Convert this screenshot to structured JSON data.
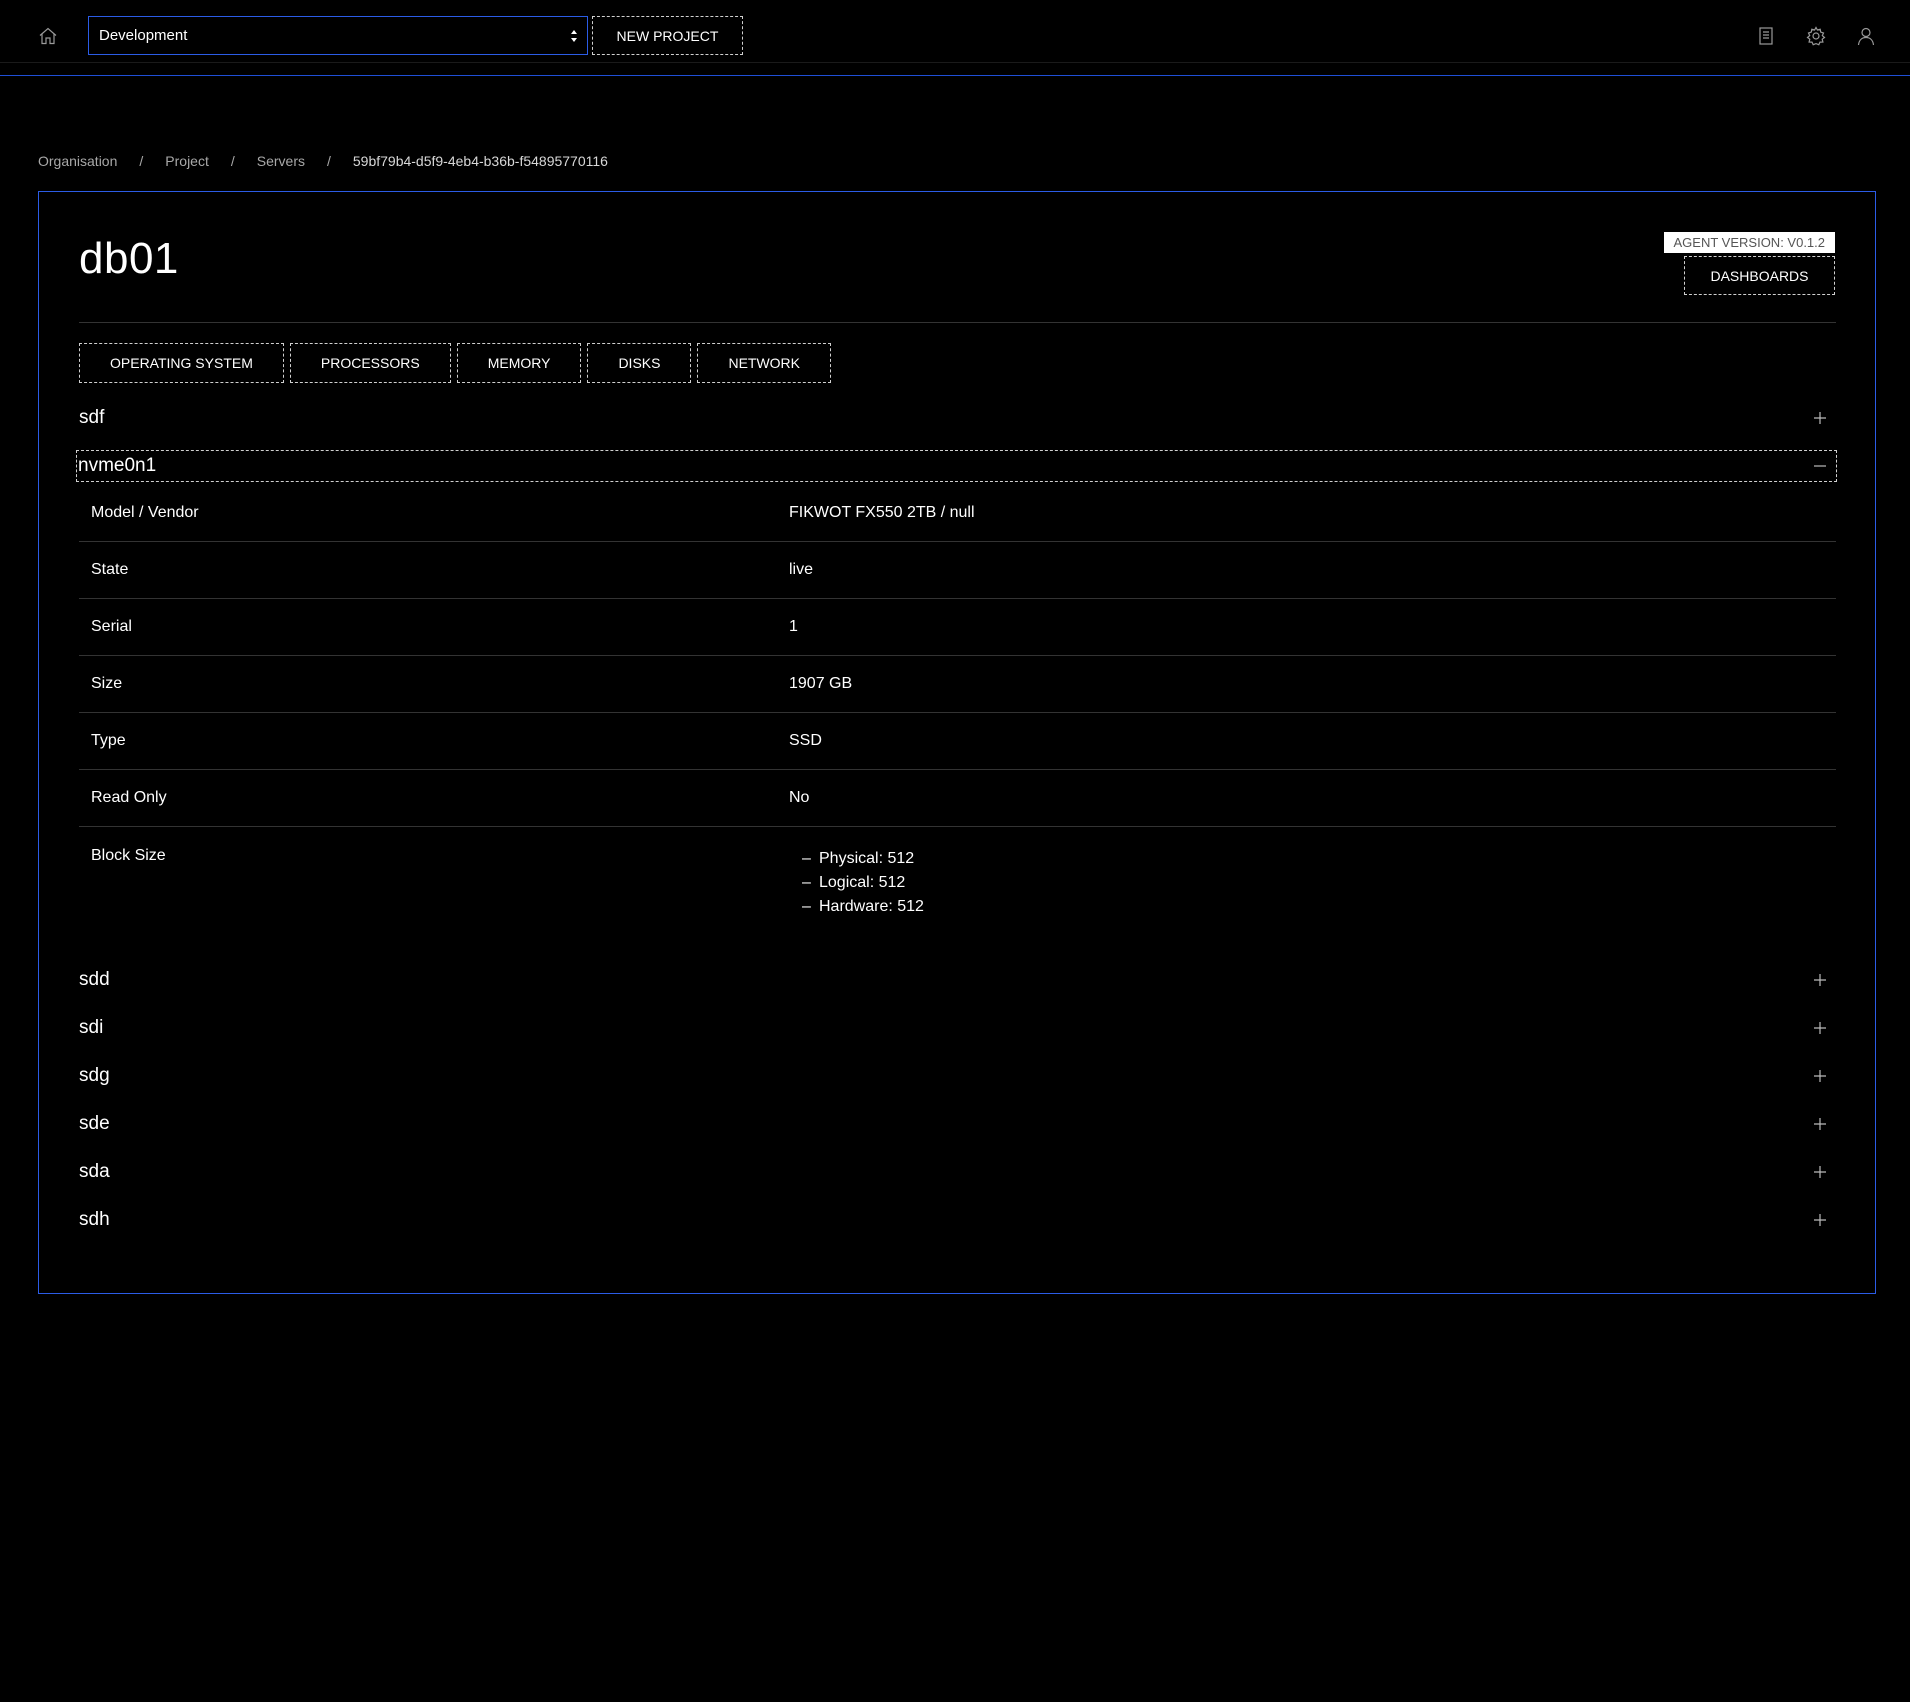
{
  "header": {
    "project_select": {
      "value": "Development"
    },
    "new_project_label": "NEW PROJECT"
  },
  "breadcrumb": [
    {
      "label": "Organisation"
    },
    {
      "label": "Project"
    },
    {
      "label": "Servers"
    },
    {
      "label": "59bf79b4-d5f9-4eb4-b36b-f54895770116"
    }
  ],
  "server": {
    "name": "db01",
    "agent_version": "AGENT VERSION: V0.1.2",
    "dashboards_label": "DASHBOARDS"
  },
  "tabs": [
    {
      "label": "OPERATING SYSTEM"
    },
    {
      "label": "PROCESSORS"
    },
    {
      "label": "MEMORY"
    },
    {
      "label": "DISKS"
    },
    {
      "label": "NETWORK"
    }
  ],
  "disks": [
    {
      "name": "sdf",
      "expanded": false
    },
    {
      "name": "nvme0n1",
      "expanded": true
    },
    {
      "name": "sdd",
      "expanded": false
    },
    {
      "name": "sdi",
      "expanded": false
    },
    {
      "name": "sdg",
      "expanded": false
    },
    {
      "name": "sde",
      "expanded": false
    },
    {
      "name": "sda",
      "expanded": false
    },
    {
      "name": "sdh",
      "expanded": false
    }
  ],
  "details": {
    "model_vendor": {
      "label": "Model / Vendor",
      "value": "FIKWOT FX550 2TB / null"
    },
    "state": {
      "label": "State",
      "value": "live"
    },
    "serial": {
      "label": "Serial",
      "value": "1"
    },
    "size": {
      "label": "Size",
      "value": "1907 GB"
    },
    "type": {
      "label": "Type",
      "value": "SSD"
    },
    "read_only": {
      "label": "Read Only",
      "value": "No"
    },
    "block_size": {
      "label": "Block Size",
      "items": [
        "Physical: 512",
        "Logical: 512",
        "Hardware: 512"
      ]
    }
  },
  "colors": {
    "accent": "#2b5ce6",
    "background": "#000000",
    "text": "#ffffff",
    "muted": "#a8a8a8",
    "divider": "#333333"
  },
  "icons": {
    "home": "home-icon",
    "docs": "document-icon",
    "settings": "gear-icon",
    "user": "user-icon",
    "expand": "plus-icon",
    "collapse": "minus-icon"
  }
}
